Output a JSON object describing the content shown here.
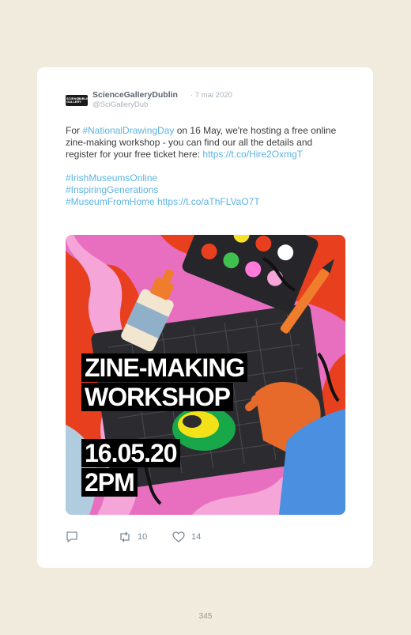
{
  "tweet": {
    "avatar_left": "SCIENCE GALLERY",
    "avatar_right": "DUBLIN",
    "display_name": "ScienceGalleryDublin",
    "date": "· 7 mai 2020",
    "handle": "@SciGalleryDub",
    "text": {
      "p1": "For ",
      "hashtag1": "#NationalDrawingDay",
      "p2": " on 16 May, we're hosting a free online zine-making workshop - you can find our all the details and register for your free ticket here: ",
      "link1": "https://t.co/Hire2OxmgT",
      "hashtag2": "#IrishMuseumsOnline",
      "hashtag3": "#InspiringGenerations",
      "hashtag4": "#MuseumFromHome",
      "link2": "https://t.co/aThFLVaO7T"
    },
    "image": {
      "title_line1": "ZINE-MAKING",
      "title_line2": "WORKSHOP",
      "date_line": "16.05.20",
      "time_line": "2PM"
    },
    "actions": {
      "reply_count": "",
      "retweet_count": "10",
      "like_count": "14"
    }
  },
  "page_number": "345",
  "colors": {
    "background": "#f0ebdd",
    "link": "#5cb3e2",
    "pink": "#e86fbf",
    "red": "#e8401f",
    "orange": "#f07d2c",
    "blue": "#4a8fe0"
  }
}
